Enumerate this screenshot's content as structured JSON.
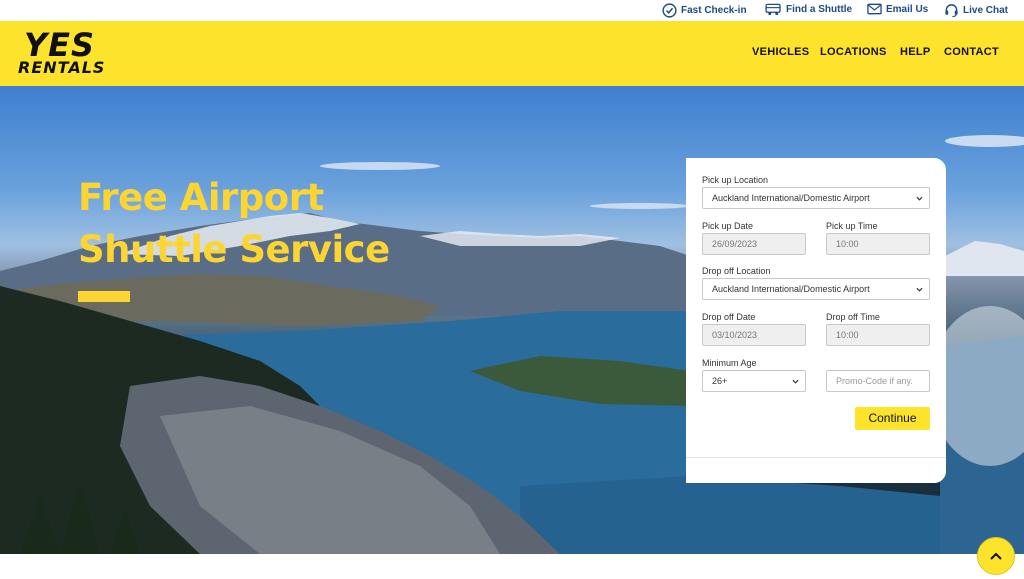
{
  "utility_bar": {
    "fast_checkin": "Fast Check-in",
    "find_shuttle": "Find a Shuttle",
    "email_us": "Email Us",
    "live_chat": "Live Chat"
  },
  "brand": {
    "line1": "YES",
    "line2": "RENTALS"
  },
  "nav": {
    "vehicles": "VEHICLES",
    "locations": "LOCATIONS",
    "help": "HELP",
    "contact": "CONTACT"
  },
  "hero": {
    "title": "Free Airport Shuttle Service"
  },
  "booking": {
    "pickup_location_label": "Pick up Location",
    "pickup_location_value": "Auckland International/Domestic Airport",
    "pickup_date_label": "Pick up Date",
    "pickup_date_value": "26/09/2023",
    "pickup_time_label": "Pick up Time",
    "pickup_time_value": "10:00",
    "dropoff_location_label": "Drop off Location",
    "dropoff_location_value": "Auckland International/Domestic Airport",
    "dropoff_date_label": "Drop off Date",
    "dropoff_date_value": "03/10/2023",
    "dropoff_time_label": "Drop off Time",
    "dropoff_time_value": "10:00",
    "min_age_label": "Minimum Age",
    "min_age_value": "26+",
    "promo_placeholder": "Promo-Code if any.",
    "continue_label": "Continue"
  },
  "colors": {
    "brand_yellow": "#fde32b",
    "nav_blue": "#1f4a85"
  },
  "icons": [
    "check-circle-icon",
    "shuttle-bus-icon",
    "envelope-icon",
    "headset-icon",
    "chevron-down-icon",
    "chevron-up-icon"
  ]
}
